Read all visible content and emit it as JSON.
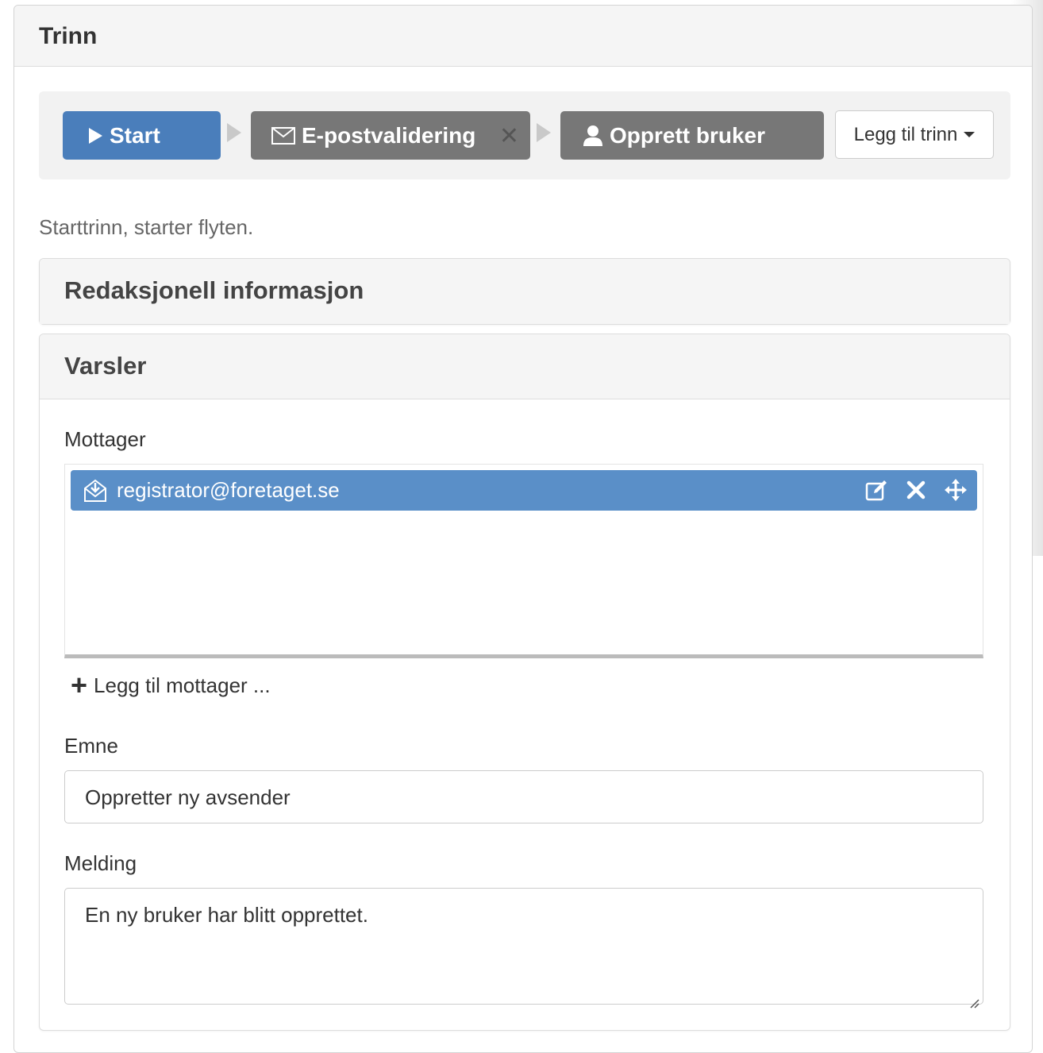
{
  "panel": {
    "title": "Trinn"
  },
  "steps": [
    {
      "label": "Start",
      "icon": "play-icon",
      "color": "#4a7ebb"
    },
    {
      "label": "E-postvalidering",
      "icon": "envelope-icon",
      "remove": "✕",
      "color": "#777777"
    },
    {
      "label": "Opprett bruker",
      "icon": "user-icon",
      "color": "#777777"
    }
  ],
  "add_step": {
    "label": "Legg til trinn"
  },
  "step_description": "Starttrinn, starter flyten.",
  "sections": {
    "editorial": {
      "title": "Redaksjonell informasjon"
    },
    "notifications": {
      "title": "Varsler",
      "recipient_label": "Mottager",
      "recipients": [
        {
          "email": "registrator@foretaget.se",
          "icon": "mail-download-icon"
        }
      ],
      "add_recipient_label": "Legg til mottager ...",
      "subject_label": "Emne",
      "subject_value": "Oppretter ny avsender",
      "message_label": "Melding",
      "message_value": "En ny bruker har blitt opprettet."
    }
  }
}
